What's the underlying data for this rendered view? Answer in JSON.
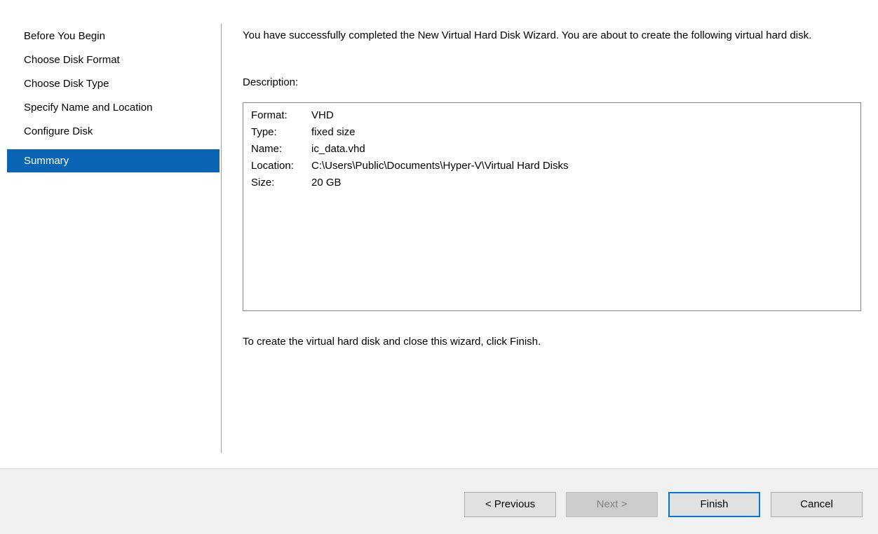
{
  "wizard": {
    "steps": [
      {
        "label": "Before You Begin",
        "active": false
      },
      {
        "label": "Choose Disk Format",
        "active": false
      },
      {
        "label": "Choose Disk Type",
        "active": false
      },
      {
        "label": "Specify Name and Location",
        "active": false
      },
      {
        "label": "Configure Disk",
        "active": false
      },
      {
        "label": "Summary",
        "active": true
      }
    ]
  },
  "summary": {
    "intro": "You have successfully completed the New Virtual Hard Disk Wizard. You are about to create the following virtual hard disk.",
    "description_label": "Description:",
    "details": [
      {
        "key": "Format:",
        "value": "VHD"
      },
      {
        "key": "Type:",
        "value": "fixed size"
      },
      {
        "key": "Name:",
        "value": "ic_data.vhd"
      },
      {
        "key": "Location:",
        "value": "C:\\Users\\Public\\Documents\\Hyper-V\\Virtual Hard Disks"
      },
      {
        "key": "Size:",
        "value": "20 GB"
      }
    ],
    "finish_hint": "To create the virtual hard disk and close this wizard, click Finish."
  },
  "buttons": {
    "previous": "< Previous",
    "next": "Next >",
    "finish": "Finish",
    "cancel": "Cancel"
  },
  "colors": {
    "active_step_bg": "#0a64b4",
    "footer_bg": "#f0f0f0",
    "focus_border": "#0078d7"
  }
}
